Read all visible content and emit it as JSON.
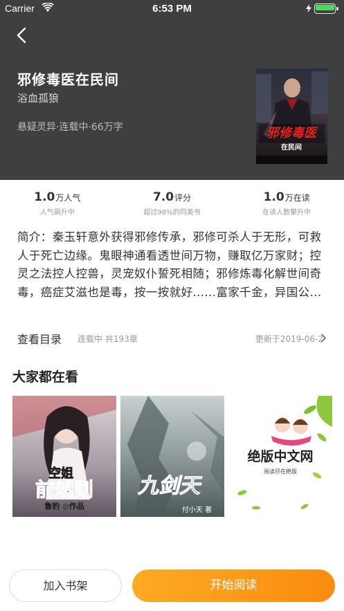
{
  "status_bar": {
    "carrier": "Carrier",
    "time": "6:53 PM",
    "battery_level": 1.0
  },
  "book": {
    "title": "邪修毒医在民间",
    "author": "浴血孤狼",
    "meta": "悬疑灵异·连载中·66万字",
    "cover_title": "邪修毒医",
    "cover_subtitle": "在民间"
  },
  "stats": [
    {
      "num": "1.0",
      "unit": "万人气",
      "sub": "人气飙升中"
    },
    {
      "num": "7.0",
      "unit": "评分",
      "sub": "超过98%的同类书"
    },
    {
      "num": "1.0",
      "unit": "万在读",
      "sub": "在读人数攀升中"
    }
  ],
  "intro": {
    "text": "简介：秦玉轩意外获得邪修传承，邪修可杀人于无形，可救人于死亡边缘。鬼眼神通看透世间万物，赚取亿万家财；控灵之法控人控兽，灵宠奴仆誓死相随；邪修炼毒化解世间奇毒，癌症艾滋也是毒，按一按就好......富家千金，异国公..."
  },
  "toc": {
    "link": "查看目录",
    "status": "连载中 共193章",
    "update": "更新于2019-06-2"
  },
  "recommend": {
    "title": "大家都在看",
    "books": [
      {
        "cover_title": "前规则",
        "cover_top": "空姐",
        "cover_author": "鲁豹 ◎作品"
      },
      {
        "cover_title": "九剑天",
        "cover_author": "付小天 著"
      },
      {
        "cover_title": "绝版中文网",
        "cover_sub": "阅读尽在绝版"
      }
    ]
  },
  "buttons": {
    "add_shelf": "加入书架",
    "start_read": "开始阅读"
  },
  "colors": {
    "header_bg": "#3f3f3f",
    "accent_start": "#fdaa25",
    "accent_end": "#fb8c10"
  }
}
